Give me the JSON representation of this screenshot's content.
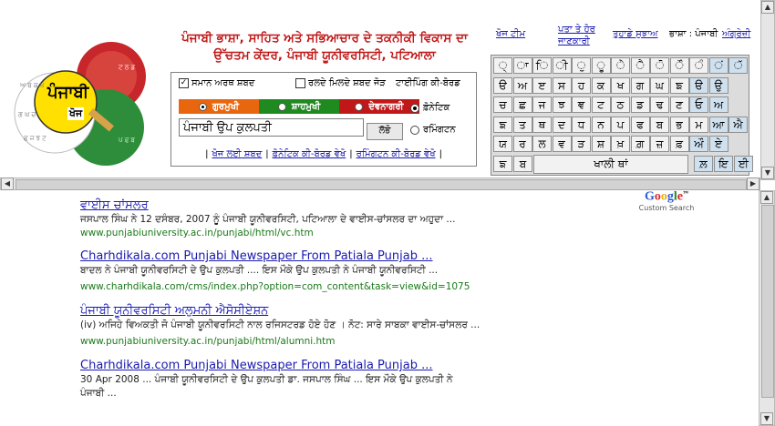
{
  "header": {
    "logo_text": "ਪੰਜਾਬੀ",
    "logo_sub": "ਖੋਜ",
    "title": "ਪੰਜਾਬੀ ਭਾਸ਼ਾ, ਸਾਹਿਤ ਅਤੇ ਸਭਿਆਚਾਰ ਦੇ ਤਕਨੀਕੀ ਵਿਕਾਸ ਦਾ ਉੱਚਤਮ ਕੇਂਦਰ, ਪੰਜਾਬੀ ਯੂਨੀਵਰਸਿਟੀ, ਪਟਿਆਲਾ"
  },
  "nav": {
    "search_team": "ਖੋਜ ਟੀਮ",
    "address": "ਪਤਾ ਤੇ ਹੋਰ ਜਾਣਕਾਰੀ",
    "feedback": "ਤੁਹਾਡੇ ਸੁਝਾਅ",
    "language_label": "ਭਾਸ਼ਾ : ਪੰਜਾਬੀ",
    "english": "ਅੰਗ੍ਰੇਜ਼ੀ"
  },
  "search": {
    "same_meaning": "ਸਮਾਨ ਅਰਥ ਸ਼ਬਦ",
    "mixed_words": "ਰਲਦੇ ਮਿਲਦੇ ਸ਼ਬਦ ਜੋੜ",
    "typing_keyboard": "ਟਾਈਪਿੰਗ ਕੀ-ਬੋਰਡ",
    "script_gurmukhi": "ਗੁਰਮੁਖੀ",
    "script_shahmukhi": "ਸ਼ਾਹਮੁਖੀ",
    "script_devanagari": "ਦੇਵਨਾਗਰੀ",
    "query": "ਪੰਜਾਬੀ ਉਪ ਕੁਲਪਤੀ",
    "go": "ਲੱਭੋ",
    "phonetic": "ਫ਼ੋਨੇਟਿਕ",
    "remington": "ਰਮਿੰਗਟਨ",
    "link_search_words": "ਖੋਜ ਲਈ ਸ਼ਬਦ",
    "link_phonetic": "ਫ਼ੋਨੇਟਿਕ ਕੀ-ਬੋਰਡ ਵੇਖੋ",
    "link_remington": "ਰਮਿੰਗਟਨ ਕੀ-ਬੋਰਡ ਵੇਖੋ",
    "sep": "|"
  },
  "keyboard": {
    "rows": [
      [
        "੍",
        "ਾ",
        "ਿ",
        "ੀ",
        "ੁ",
        "ੂ",
        "ੇ",
        "ੈ",
        "ੋ",
        "ੌ",
        "ੰ",
        "ਂ",
        "ੱ"
      ],
      [
        "ੳ",
        "ਅ",
        "ੲ",
        "ਸ",
        "ਹ",
        "ਕ",
        "ਖ",
        "ਗ",
        "ਘ",
        "ਙ",
        "ੳ",
        "ਉ"
      ],
      [
        "ਚ",
        "ਛ",
        "ਜ",
        "ਝ",
        "ਞ",
        "ਟ",
        "ਠ",
        "ਡ",
        "ਢ",
        "ਣ",
        "ਓ",
        "ਅ"
      ],
      [
        "ਙ",
        "ਤ",
        "ਥ",
        "ਦ",
        "ਧ",
        "ਨ",
        "ਪ",
        "ਫ",
        "ਬ",
        "ਭ",
        "ਮ",
        "ਆ",
        "ਐ"
      ],
      [
        "ਯ",
        "ਰ",
        "ਲ",
        "ਵ",
        "ੜ",
        "ਸ਼",
        "ਖ਼",
        "ਗ਼",
        "ਜ਼",
        "ਫ਼",
        "ਔ",
        "ਏ"
      ],
      [
        "ਙ",
        "ਬ",
        "ਲ਼",
        "ਇ",
        "ਈ"
      ]
    ],
    "space": "ਖਾਲੀ ਥਾਂ"
  },
  "google": {
    "logo": "Google",
    "custom": "Custom Search"
  },
  "results": [
    {
      "title": "ਵਾਈਸ ਚਾਂਸਲਰ",
      "snippet": "ਜਸਪਾਲ ਸਿੰਘ ਨੇ 12 ਦਸੰਬਰ, 2007 ਨੂੰ ਪੰਜਾਬੀ ਯੂਨੀਵਰਸਿਟੀ, ਪਟਿਆਲਾ ਦੇ ਵਾਈਸ-ਚਾਂਸਲਰ ਦਾ ਅਹੁਦਾ ...",
      "snippet2": "",
      "url": "www.punjabiuniversity.ac.in/punjabi/html/vc.htm"
    },
    {
      "title": "Charhdikala.com Punjabi Newspaper From Patiala Punjab ...",
      "snippet": "ਬਾਦਲ ਨੇ ਪੰਜਾਬੀ ਯੂਨੀਵਰਸਿਟੀ ਦੇ ਉਪ ਕੁਲਪਤੀ .... ਇਸ ਮੌਕੇ ਉਪ ਕੁਲਪਤੀ ਨੇ ਪੰਜਾਬੀ ਯੂਨੀਵਰਸਿਟੀ ...",
      "snippet2": "",
      "url": "www.charhdikala.com/cms/index.php?option=com_content&task=view&id=1075"
    },
    {
      "title": "ਪੰਜਾਬੀ ਯੂਨੀਵਰਸਿਟੀ ਅਲੁਮਨੀ ਐਸੋਸੀਏਸ਼ਨ",
      "snippet": "(iv) ਅਜਿਹੇ ਵਿਅਕਤੀ ਜੋ ਪੰਜਾਬੀ ਯੂਨੀਵਰਸਿਟੀ ਨਾਲ ਰਜਿਸਟਰਡ ਹੋਏ ਹੋਣ । ਨੋਟ: ਸਾਰੇ ਸਾਬਕਾ ਵਾਈਸ-ਚਾਂਸਲਰ ...",
      "snippet2": "",
      "url": "www.punjabiuniversity.ac.in/punjabi/html/alumni.htm"
    },
    {
      "title": "Charhdikala.com Punjabi Newspaper From Patiala Punjab ...",
      "snippet": "30 Apr 2008 ... ਪੰਜਾਬੀ ਯੂਨੀਵਰਸਿਟੀ ਦੇ ਉਪ ਕੁਲਪਤੀ ਡਾ. ਜਸਪਾਲ ਸਿੰਘ ... ਇਸ ਮੌਕੇ ਉਪ ਕੁਲਪਤੀ ਨੇ",
      "snippet2": "ਪੰਜਾਬੀ ...",
      "url": ""
    }
  ],
  "colors": {
    "gurmukhi": "#e8670e",
    "shahmukhi": "#1f8a1f",
    "devanagari": "#c01818",
    "link": "#1a1ab0",
    "url": "#1a7a1a"
  }
}
